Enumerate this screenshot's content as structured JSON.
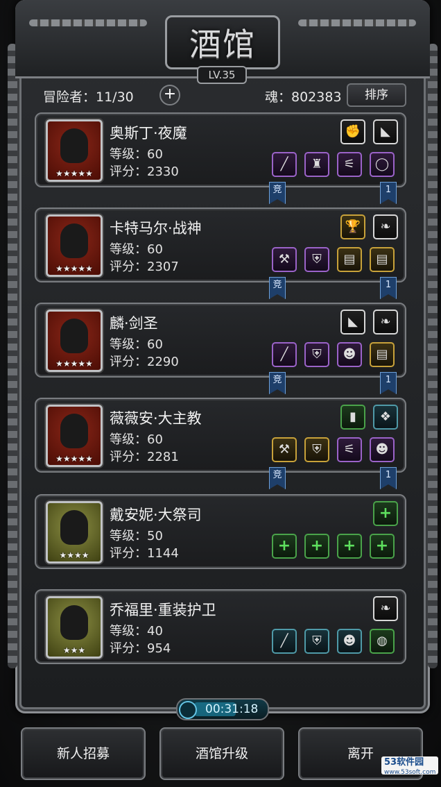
{
  "header": {
    "title": "酒馆",
    "level": "LV.35"
  },
  "topbar": {
    "adventurers": "冒险者：11/30",
    "add": "+",
    "soul": "魂：802383",
    "sort": "排序"
  },
  "heroes": [
    {
      "name": "奥斯丁·夜魔",
      "level": "等级：60",
      "score": "评分：2330",
      "stars": "★★★★★",
      "frame": "red",
      "top_icons": [
        {
          "icon": "gauntlet-icon",
          "glyph": "✊",
          "tier": "white"
        },
        {
          "icon": "cloak-icon",
          "glyph": "◣",
          "tier": "white"
        }
      ],
      "bottom_icons": [
        {
          "icon": "dagger-icon",
          "glyph": "╱",
          "tier": "purple"
        },
        {
          "icon": "armor-icon",
          "glyph": "♜",
          "tier": "purple"
        },
        {
          "icon": "claw-icon",
          "glyph": "⚟",
          "tier": "purple"
        },
        {
          "icon": "ring-icon",
          "glyph": "◯",
          "tier": "purple"
        }
      ],
      "arena": "竞",
      "rank": "1"
    },
    {
      "name": "卡特马尔·战神",
      "level": "等级：60",
      "score": "评分：2307",
      "stars": "★★★★★",
      "frame": "red",
      "top_icons": [
        {
          "icon": "trophy-icon",
          "glyph": "🏆",
          "tier": "gold"
        },
        {
          "icon": "feather-icon",
          "glyph": "❧",
          "tier": "white"
        }
      ],
      "bottom_icons": [
        {
          "icon": "axe-icon",
          "glyph": "⚒",
          "tier": "purple"
        },
        {
          "icon": "shoulder-armor-icon",
          "glyph": "⛨",
          "tier": "purple"
        },
        {
          "icon": "scroll-icon",
          "glyph": "▤",
          "tier": "gold"
        },
        {
          "icon": "scroll-icon",
          "glyph": "▤",
          "tier": "gold"
        }
      ],
      "arena": "竞",
      "rank": "1"
    },
    {
      "name": "麟·剑圣",
      "level": "等级：60",
      "score": "评分：2290",
      "stars": "★★★★★",
      "frame": "red",
      "top_icons": [
        {
          "icon": "cloak-icon",
          "glyph": "◣",
          "tier": "white"
        },
        {
          "icon": "feather-icon",
          "glyph": "❧",
          "tier": "white"
        }
      ],
      "bottom_icons": [
        {
          "icon": "dagger-icon",
          "glyph": "╱",
          "tier": "purple"
        },
        {
          "icon": "shoulder-armor-icon",
          "glyph": "⛨",
          "tier": "purple"
        },
        {
          "icon": "mask-icon",
          "glyph": "☻",
          "tier": "purple"
        },
        {
          "icon": "scroll-icon",
          "glyph": "▤",
          "tier": "gold"
        }
      ],
      "arena": "竞",
      "rank": "1"
    },
    {
      "name": "薇薇安·大主教",
      "level": "等级：60",
      "score": "评分：2281",
      "stars": "★★★★★",
      "frame": "red",
      "top_icons": [
        {
          "icon": "spellbook-icon",
          "glyph": "▮",
          "tier": "green"
        },
        {
          "icon": "crystal-icon",
          "glyph": "❖",
          "tier": "teal"
        }
      ],
      "bottom_icons": [
        {
          "icon": "axe-icon",
          "glyph": "⚒",
          "tier": "gold"
        },
        {
          "icon": "shoulder-armor-icon",
          "glyph": "⛨",
          "tier": "gold"
        },
        {
          "icon": "claw-icon",
          "glyph": "⚟",
          "tier": "purple"
        },
        {
          "icon": "mask-icon",
          "glyph": "☻",
          "tier": "purple"
        }
      ],
      "arena": "竞",
      "rank": "1"
    },
    {
      "name": "戴安妮·大祭司",
      "level": "等级：50",
      "score": "评分：1144",
      "stars": "★★★★",
      "frame": "yellow",
      "top_icons": [
        {
          "icon": "plus-icon",
          "glyph": "+",
          "tier": "green"
        }
      ],
      "bottom_icons": [
        {
          "icon": "plus-icon",
          "glyph": "+",
          "tier": "green"
        },
        {
          "icon": "plus-icon",
          "glyph": "+",
          "tier": "green"
        },
        {
          "icon": "plus-icon",
          "glyph": "+",
          "tier": "green"
        },
        {
          "icon": "plus-icon",
          "glyph": "+",
          "tier": "green"
        }
      ],
      "arena": "",
      "rank": ""
    },
    {
      "name": "乔福里·重装护卫",
      "level": "等级：40",
      "score": "评分：954",
      "stars": "★★★",
      "frame": "yellow",
      "top_icons": [
        {
          "icon": "feather-icon",
          "glyph": "❧",
          "tier": "white"
        }
      ],
      "bottom_icons": [
        {
          "icon": "sword-icon",
          "glyph": "╱",
          "tier": "teal"
        },
        {
          "icon": "shoulder-armor-icon",
          "glyph": "⛨",
          "tier": "teal"
        },
        {
          "icon": "mask-icon",
          "glyph": "☻",
          "tier": "teal"
        },
        {
          "icon": "barrel-icon",
          "glyph": "◍",
          "tier": "green"
        }
      ],
      "arena": "",
      "rank": ""
    }
  ],
  "timer": "00:31:18",
  "buttons": {
    "recruit": "新人招募",
    "upgrade": "酒馆升级",
    "leave": "离开"
  },
  "watermark": {
    "line1": "53软件园",
    "line2": "www.53soft.com"
  }
}
